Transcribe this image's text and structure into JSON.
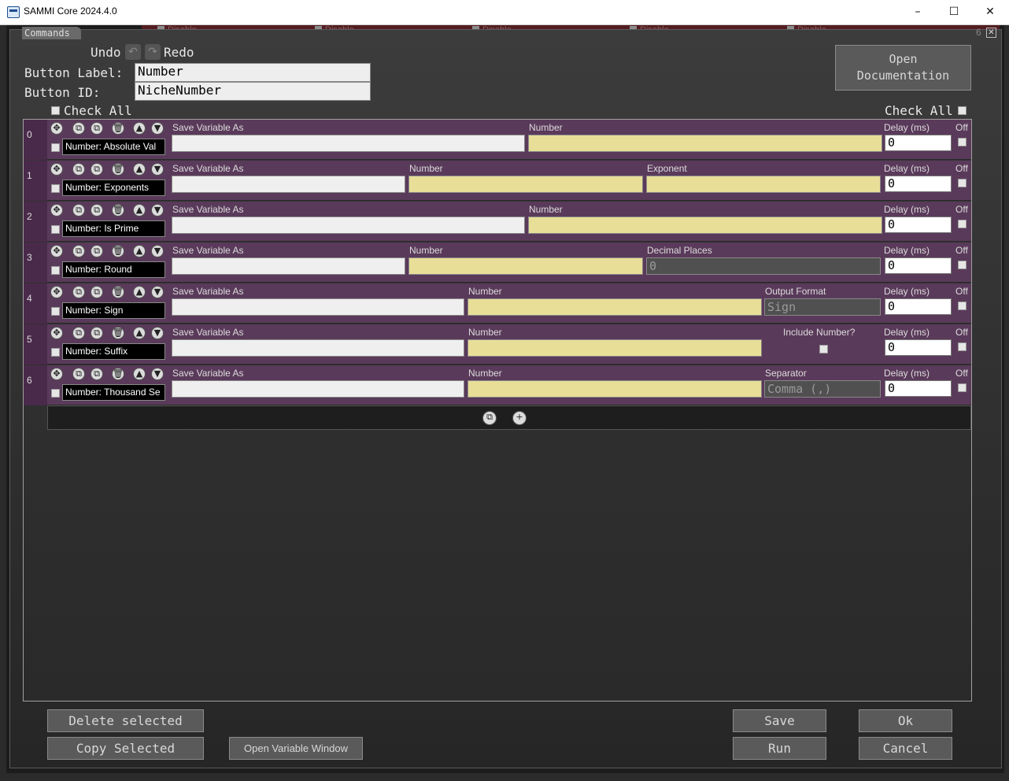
{
  "window": {
    "title": "SAMMI Core 2024.4.0"
  },
  "tabs": {
    "commands_label": "Commands",
    "disable_label": "Disable",
    "page_num": "6"
  },
  "header": {
    "undo": "Undo",
    "redo": "Redo",
    "button_label_label": "Button Label:",
    "button_label_value": "Number",
    "button_id_label": "Button ID:",
    "button_id_value": "NicheNumber",
    "check_all": "Check All",
    "open_documentation": "Open\nDocumentation"
  },
  "rows": [
    {
      "index": "0",
      "name": "Number: Absolute Val",
      "delay": "0",
      "fields": [
        {
          "label": "Save Variable As",
          "value": "",
          "style": "white"
        },
        {
          "label": "Number",
          "value": "",
          "style": "yellow"
        }
      ]
    },
    {
      "index": "1",
      "name": "Number: Exponents",
      "delay": "0",
      "fields": [
        {
          "label": "Save Variable As",
          "value": "",
          "style": "white"
        },
        {
          "label": "Number",
          "value": "",
          "style": "yellow"
        },
        {
          "label": "Exponent",
          "value": "",
          "style": "yellow"
        }
      ]
    },
    {
      "index": "2",
      "name": "Number: Is Prime",
      "delay": "0",
      "fields": [
        {
          "label": "Save Variable As",
          "value": "",
          "style": "white"
        },
        {
          "label": "Number",
          "value": "",
          "style": "yellow"
        }
      ]
    },
    {
      "index": "3",
      "name": "Number: Round",
      "delay": "0",
      "fields": [
        {
          "label": "Save Variable As",
          "value": "",
          "style": "white"
        },
        {
          "label": "Number",
          "value": "",
          "style": "yellow"
        },
        {
          "label": "Decimal Places",
          "value": "0",
          "style": "grey"
        }
      ]
    },
    {
      "index": "4",
      "name": "Number: Sign",
      "delay": "0",
      "fields": [
        {
          "label": "Save Variable As",
          "value": "",
          "style": "white"
        },
        {
          "label": "Number",
          "value": "",
          "style": "yellow"
        },
        {
          "label": "Output Format",
          "value": "Sign",
          "style": "grey"
        }
      ]
    },
    {
      "index": "5",
      "name": "Number: Suffix",
      "delay": "0",
      "fields": [
        {
          "label": "Save Variable As",
          "value": "",
          "style": "white"
        },
        {
          "label": "Number",
          "value": "",
          "style": "yellow"
        },
        {
          "label": "Include Number?",
          "value": "",
          "style": "checkbox"
        }
      ]
    },
    {
      "index": "6",
      "name": "Number: Thousand Se",
      "delay": "0",
      "fields": [
        {
          "label": "Save Variable As",
          "value": "",
          "style": "white"
        },
        {
          "label": "Number",
          "value": "",
          "style": "yellow"
        },
        {
          "label": "Separator",
          "value": "Comma (,)",
          "style": "grey"
        }
      ]
    }
  ],
  "row_labels": {
    "delay": "Delay (ms)",
    "off": "Off"
  },
  "footer": {
    "delete_selected": "Delete selected",
    "copy_selected": "Copy Selected",
    "open_variable_window": "Open Variable Window",
    "save": "Save",
    "run": "Run",
    "ok": "Ok",
    "cancel": "Cancel"
  },
  "colors": {
    "row_bg": "#5a3a5a",
    "yellow_field": "#e8de98",
    "accent_tab": "#5a1e22"
  }
}
